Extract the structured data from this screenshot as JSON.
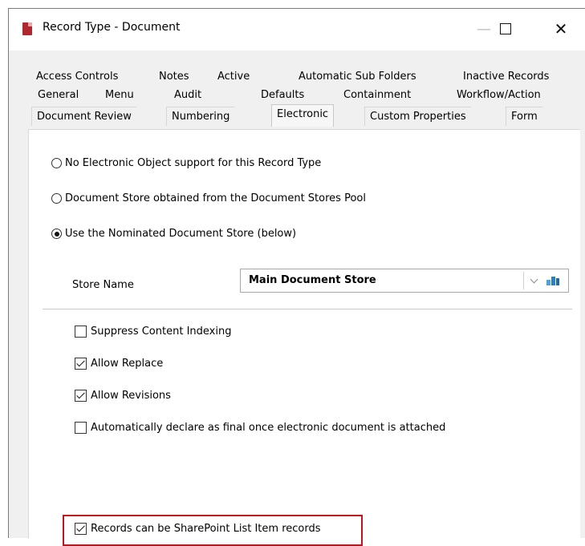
{
  "window": {
    "title": "Record Type - Document",
    "minimize_glyph": "—",
    "close_glyph": "✕"
  },
  "tabs": {
    "row1": [
      "Access Controls",
      "Notes",
      "Active",
      "Automatic Sub Folders",
      "Inactive Records"
    ],
    "row2": [
      "General",
      "Menu",
      "Audit",
      "Defaults",
      "Containment",
      "Workflow/Action"
    ],
    "row3": [
      "Document Review",
      "Numbering",
      "Electronic",
      "Custom Properties",
      "Form"
    ],
    "active": "Electronic"
  },
  "electronic": {
    "radios": [
      {
        "label": "No Electronic Object support for this Record Type",
        "checked": false
      },
      {
        "label": "Document Store obtained from the Document Stores Pool",
        "checked": false
      },
      {
        "label": "Use the Nominated Document Store (below)",
        "checked": true
      }
    ],
    "store_name_label": "Store Name",
    "store_name_value": "Main Document Store",
    "checkboxes": [
      {
        "label": "Suppress Content Indexing",
        "checked": false
      },
      {
        "label": "Allow Replace",
        "checked": true
      },
      {
        "label": "Allow Revisions",
        "checked": true
      },
      {
        "label": "Automatically declare as final once electronic document is attached",
        "checked": false
      },
      {
        "label": "Records can be SharePoint List Item records",
        "checked": true
      }
    ]
  },
  "icons": {
    "app": "record-type-icon",
    "dropdown": "chevron-down-icon",
    "lookup": "lookup-icon"
  },
  "colors": {
    "highlight": "#c0151c",
    "app_icon": "#b0282f"
  }
}
